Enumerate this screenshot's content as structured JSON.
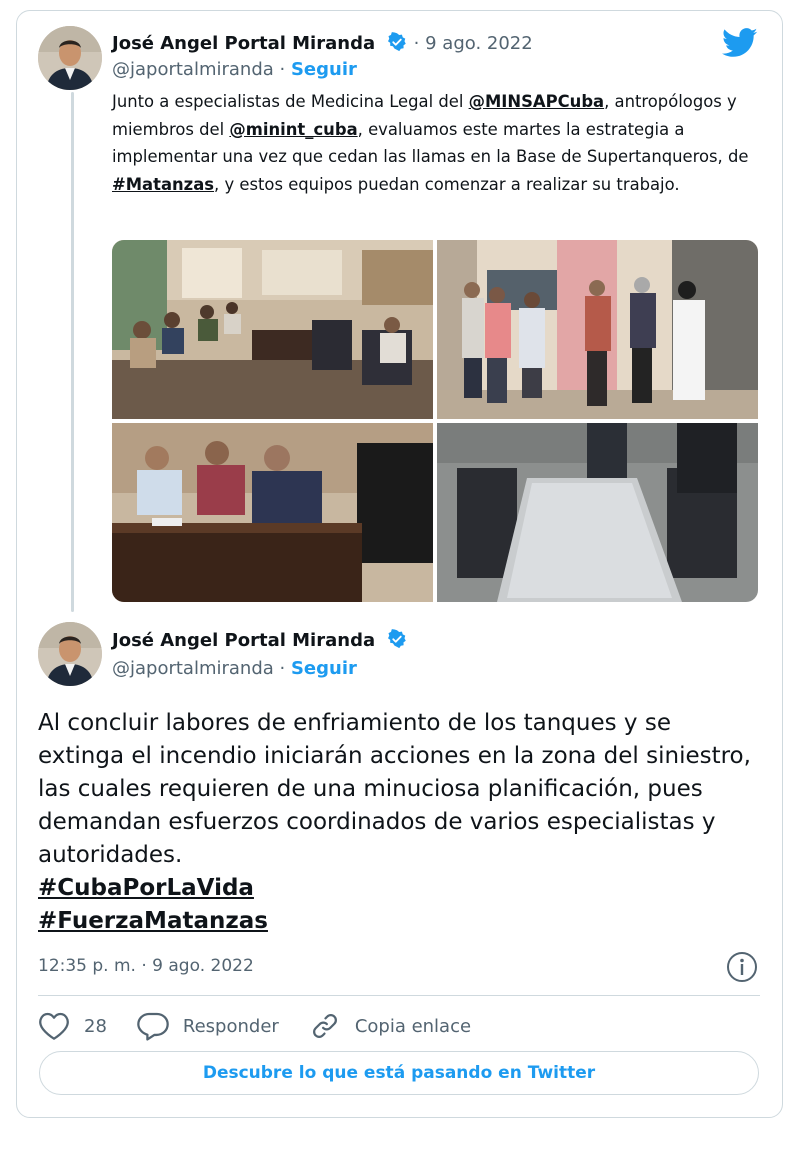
{
  "tweet1": {
    "author_name": "José Angel Portal Miranda",
    "date": "· 9 ago. 2022",
    "handle": "@japortalmiranda",
    "separator": " · ",
    "follow_label": "Seguir",
    "text": {
      "p1": "Junto a especialistas de Medicina Legal del ",
      "m1": "@MINSAPCuba",
      "p2": ", antropólogos y miembros del ",
      "m2": "@minint_cuba",
      "p3": ", evaluamos este martes la estrategia a implementar una vez que cedan las llamas en la Base de Supertanqueros, de ",
      "m3": "#Matanzas",
      "p4": ", y estos equipos puedan comenzar a realizar su trabajo."
    }
  },
  "tweet2": {
    "author_name": "José Angel Portal Miranda",
    "handle": "@japortalmiranda",
    "separator": " · ",
    "follow_label": "Seguir",
    "body": "Al concluir labores de enfriamiento de los tanques y se extinga el incendio iniciarán acciones en la zona del siniestro, las cuales requieren de una minuciosa planificación, pues demandan esfuerzos coordinados de varios especialistas y autoridades.",
    "hashtags": [
      "#CubaPorLaVida",
      "#FuerzaMatanzas"
    ],
    "timestamp": "12:35 p. m. · 9 ago. 2022"
  },
  "actions": {
    "like_count": "28",
    "reply_label": "Responder",
    "copy_link_label": "Copia enlace"
  },
  "cta_label": "Descubre lo que está pasando en Twitter",
  "icons": {
    "brand": "twitter-bird-icon",
    "verified": "verified-badge-icon",
    "info": "info-icon",
    "like": "heart-icon",
    "reply": "reply-bubble-icon",
    "copy": "link-icon"
  },
  "colors": {
    "accent": "#1d9bf0",
    "text": "#0f1419",
    "secondary": "#536471",
    "border": "#cfd9de"
  }
}
